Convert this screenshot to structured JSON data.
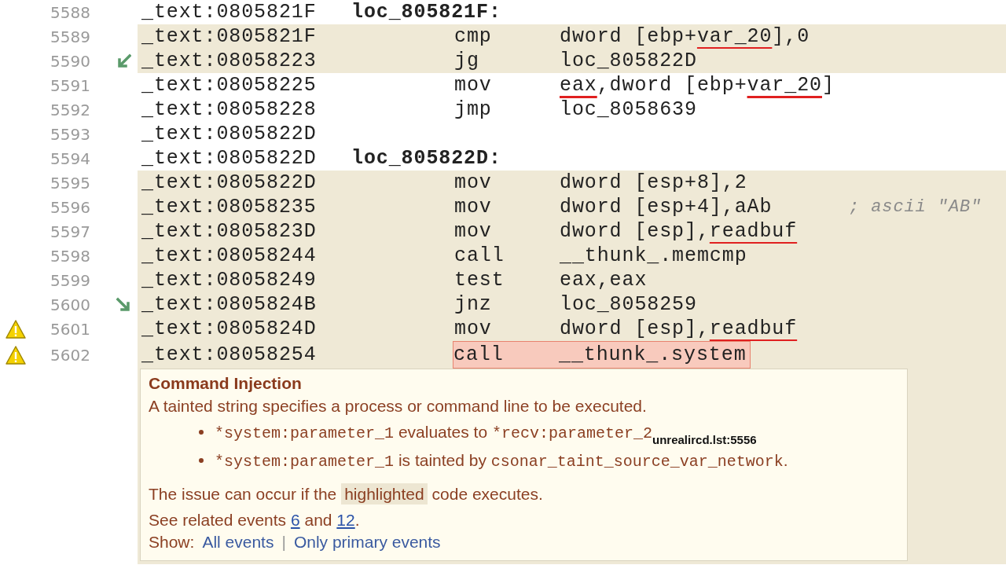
{
  "rows": [
    {
      "line": "5588",
      "address": "_text:0805821F",
      "label": "loc_805821F:",
      "shaded": false,
      "warning": false,
      "flagged": false
    },
    {
      "line": "5589",
      "address": "_text:0805821F",
      "mnemonic": "cmp",
      "operands": [
        {
          "text": "dword [ebp+",
          "underlined": false
        },
        {
          "text": "var_20",
          "underlined": true
        },
        {
          "text": "],0",
          "underlined": false
        }
      ],
      "shaded": true,
      "warning": false,
      "flagged": false
    },
    {
      "line": "5590",
      "address": "_text:08058223",
      "branch_arrow": {
        "kind": "down_left"
      },
      "mnemonic": "jg",
      "operands": [
        {
          "text": "loc_805822D",
          "underlined": false
        }
      ],
      "shaded": true,
      "warning": false,
      "flagged": false
    },
    {
      "line": "5591",
      "address": "_text:08058225",
      "mnemonic": "mov",
      "operands": [
        {
          "text": "eax",
          "underlined": true
        },
        {
          "text": ",dword [ebp+",
          "underlined": false
        },
        {
          "text": "var_20",
          "underlined": true
        },
        {
          "text": "]",
          "underlined": false
        }
      ],
      "shaded": false,
      "warning": false,
      "flagged": false
    },
    {
      "line": "5592",
      "address": "_text:08058228",
      "mnemonic": "jmp",
      "operands": [
        {
          "text": "loc_8058639",
          "underlined": false
        }
      ],
      "shaded": false,
      "warning": false,
      "flagged": false
    },
    {
      "line": "5593",
      "address": "_text:0805822D",
      "shaded": false,
      "warning": false,
      "flagged": false
    },
    {
      "line": "5594",
      "address": "_text:0805822D",
      "label": "loc_805822D:",
      "shaded": false,
      "warning": false,
      "flagged": false
    },
    {
      "line": "5595",
      "address": "_text:0805822D",
      "mnemonic": "mov",
      "operands": [
        {
          "text": "dword [esp+8],2",
          "underlined": false
        }
      ],
      "shaded": true,
      "warning": false,
      "flagged": false
    },
    {
      "line": "5596",
      "address": "_text:08058235",
      "mnemonic": "mov",
      "operands": [
        {
          "text": "dword [esp+4],aAb",
          "underlined": false
        }
      ],
      "comment": "; ascii \"AB\"",
      "shaded": true,
      "warning": false,
      "flagged": false
    },
    {
      "line": "5597",
      "address": "_text:0805823D",
      "mnemonic": "mov",
      "operands": [
        {
          "text": "dword [esp],",
          "underlined": false
        },
        {
          "text": "readbuf",
          "underlined": true
        }
      ],
      "shaded": true,
      "warning": false,
      "flagged": false
    },
    {
      "line": "5598",
      "address": "_text:08058244",
      "mnemonic": "call",
      "operands": [
        {
          "text": "__thunk_.memcmp",
          "underlined": false
        }
      ],
      "shaded": true,
      "warning": false,
      "flagged": false
    },
    {
      "line": "5599",
      "address": "_text:08058249",
      "mnemonic": "test",
      "operands": [
        {
          "text": "eax,eax",
          "underlined": false
        }
      ],
      "shaded": true,
      "warning": false,
      "flagged": false
    },
    {
      "line": "5600",
      "address": "_text:0805824B",
      "branch_arrow": {
        "kind": "down_right"
      },
      "mnemonic": "jnz",
      "operands": [
        {
          "text": "loc_8058259",
          "underlined": false
        }
      ],
      "shaded": true,
      "warning": false,
      "flagged": false
    },
    {
      "line": "5601",
      "address": "_text:0805824D",
      "mnemonic": "mov",
      "operands": [
        {
          "text": "dword [esp],",
          "underlined": false
        },
        {
          "text": "readbuf",
          "underlined": true
        }
      ],
      "shaded": true,
      "warning": true,
      "flagged": false
    },
    {
      "line": "5602",
      "address": "_text:08058254",
      "mnemonic": "call",
      "operands": [
        {
          "text": "__thunk_.system",
          "underlined": false
        }
      ],
      "shaded": true,
      "warning": true,
      "flagged": true
    }
  ],
  "issue_popup": {
    "title": "Command Injection",
    "description": "A tainted string specifies a process or command line to be executed.",
    "bullets": [
      [
        {
          "kind": "code",
          "text": "*system:parameter_1"
        },
        {
          "kind": "text",
          "text": " evaluates to "
        },
        {
          "kind": "code",
          "text": "*recv:parameter_2"
        },
        {
          "kind": "ref",
          "text": "unrealircd.lst:5556"
        }
      ],
      [
        {
          "kind": "code",
          "text": "*system:parameter_1"
        },
        {
          "kind": "text",
          "text": " is tainted by "
        },
        {
          "kind": "code",
          "text": "csonar_taint_source_var_network"
        },
        {
          "kind": "text",
          "text": "."
        }
      ]
    ],
    "condition": [
      {
        "kind": "text",
        "text": "The issue can occur if the "
      },
      {
        "kind": "highlight",
        "text": "highlighted"
      },
      {
        "kind": "text",
        "text": " code executes."
      }
    ],
    "related": [
      {
        "kind": "text",
        "text": "See related events "
      },
      {
        "kind": "link",
        "text": "6"
      },
      {
        "kind": "text",
        "text": " and "
      },
      {
        "kind": "link",
        "text": "12"
      },
      {
        "kind": "text",
        "text": "."
      }
    ],
    "show": {
      "label": "Show:",
      "links": [
        "All events",
        "Only primary events"
      ],
      "separator": "|"
    }
  }
}
